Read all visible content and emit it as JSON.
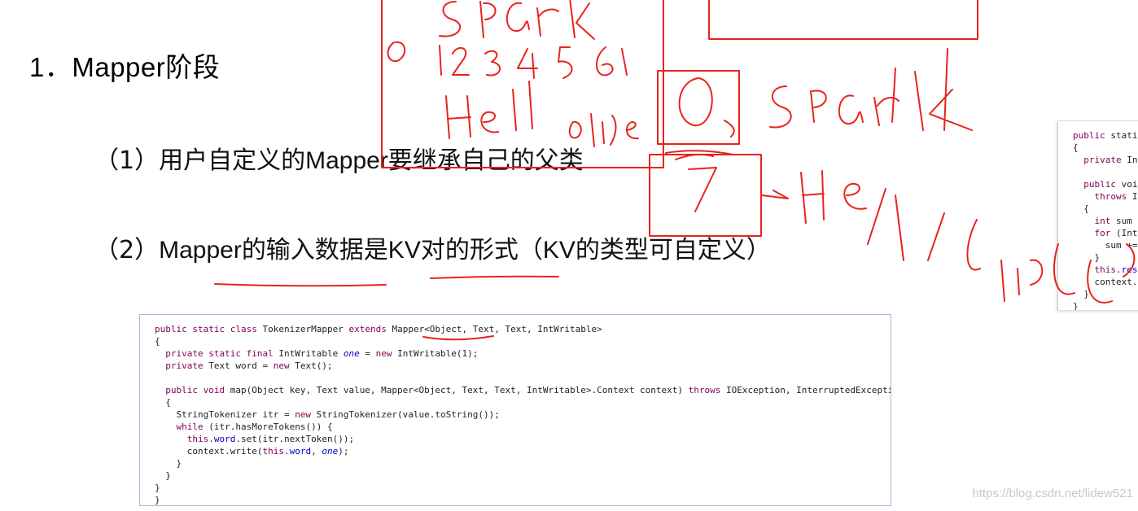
{
  "heading": "1．Mapper阶段",
  "points": [
    {
      "num": "（1）",
      "text": "用户自定义的Mapper要继承自己的父类"
    },
    {
      "num": "（2）",
      "text": "Mapper的输入数据是KV对的形式（KV的类型可自定义）"
    }
  ],
  "code_main": [
    "public static class TokenizerMapper extends Mapper<Object, Text, Text, IntWritable>",
    "{",
    "  private static final IntWritable one = new IntWritable(1);",
    "  private Text word = new Text();",
    "",
    "  public void map(Object key, Text value, Mapper<Object, Text, Text, IntWritable>.Context context) throws IOException, InterruptedExcepti",
    "  {",
    "    StringTokenizer itr = new StringTokenizer(value.toString());",
    "    while (itr.hasMoreTokens()) {",
    "      this.word.set(itr.nextToken());",
    "      context.write(this.word, one);",
    "    }",
    "  }",
    "}",
    "}"
  ],
  "code_side": [
    "public stati",
    "{",
    "  private In",
    "",
    "  public voi",
    "    throws I",
    "  {",
    "    int sum",
    "    for (Int",
    "      sum +=",
    "    }",
    "    this.res",
    "    context.",
    "  }",
    "}"
  ],
  "handwriting": {
    "top": "spark",
    "digits": "0 1 2 3 4 5 6",
    "hello_partial": "Hell",
    "big_zero": "0",
    "spark_right": "spark",
    "seven": "7",
    "hello_right": "Hello",
    "seven_hello": "7 Hello"
  },
  "watermark": "https://blog.csdn.net/lidew521",
  "colors": {
    "ink": "#e8231d",
    "code_border": "#9fbbe0",
    "keyword": "#7f0055",
    "field": "#0000c0"
  }
}
